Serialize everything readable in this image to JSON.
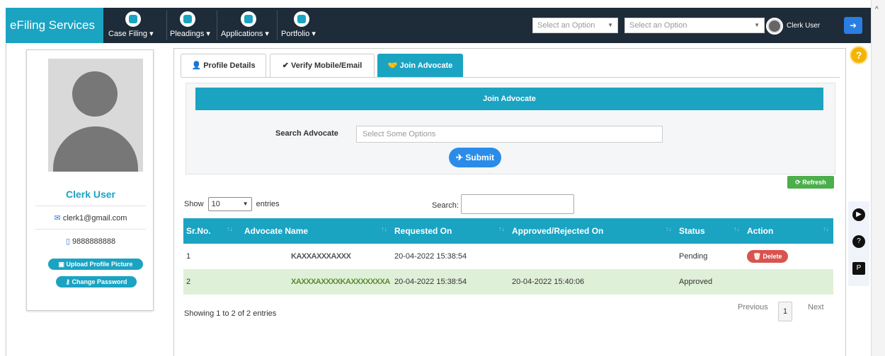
{
  "topbar": {
    "brand": "eFiling Services",
    "menus": [
      {
        "label": "Case Filing ▾",
        "icon": "pencil-icon"
      },
      {
        "label": "Pleadings ▾",
        "icon": "wifi-icon"
      },
      {
        "label": "Applications ▾",
        "icon": "document-icon"
      },
      {
        "label": "Portfolio ▾",
        "icon": "briefcase-icon"
      }
    ],
    "select1": "Select an Option",
    "select2": "Select an Option",
    "user": "Clerk User"
  },
  "profile": {
    "name": "Clerk User",
    "email": "clerk1@gmail.com",
    "phone": "9888888888",
    "upload_btn": "Upload Profile Picture",
    "change_pwd_btn": "Change Password"
  },
  "tabs": [
    {
      "label": "Profile Details"
    },
    {
      "label": "Verify Mobile/Email"
    },
    {
      "label": "Join Advocate"
    }
  ],
  "form": {
    "title": "Join Advocate",
    "search_label": "Search Advocate",
    "search_placeholder": "Select Some Options",
    "submit": "Submit",
    "refresh": "Refresh"
  },
  "table": {
    "show_label": "Show",
    "show_value": "10",
    "entries_label": "entries",
    "search_label": "Search:",
    "headers": [
      "Sr.No.",
      "Advocate Name",
      "Requested On",
      "Approved/Rejected On",
      "Status",
      "Action"
    ],
    "rows": [
      {
        "sr": "1",
        "name": "KAXXAXXXAXXX",
        "requested": "20-04-2022 15:38:54",
        "approved": "",
        "status": "Pending",
        "action": "Delete"
      },
      {
        "sr": "2",
        "name": "XAXXXAXXXXKAXXXXXXXA",
        "requested": "20-04-2022 15:38:54",
        "approved": "20-04-2022 15:40:06",
        "status": "Approved",
        "action": ""
      }
    ],
    "showing": "Showing 1 to 2 of 2 entries",
    "previous": "Previous",
    "page": "1",
    "next": "Next"
  },
  "colors": {
    "accent": "#1ba3c2",
    "nav": "#1e2b38",
    "refresh": "#4cae4c",
    "delete": "#d9534f"
  }
}
